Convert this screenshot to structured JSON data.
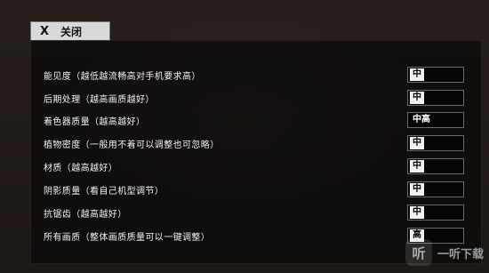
{
  "close_button": {
    "icon": "close-icon",
    "symbol": "X",
    "label": "关闭"
  },
  "settings": [
    {
      "label": "能见度（越低越流畅高对手机要求高）",
      "value": "中"
    },
    {
      "label": "后期处理（越高画质越好）",
      "value": "中"
    },
    {
      "label": "着色器质量（越高越好）",
      "value": "中高"
    },
    {
      "label": "植物密度（一般用不着可以调整也可忽略）",
      "value": "中"
    },
    {
      "label": "材质（越高越好）",
      "value": "中"
    },
    {
      "label": "阴影质量（看自己机型调节）",
      "value": "中"
    },
    {
      "label": "抗锯齿（越高越好）",
      "value": "中"
    },
    {
      "label": "所有画质（整体画质质量可以一键调整）",
      "value": "高"
    }
  ],
  "watermark": {
    "mark": "听",
    "text": "一听下载"
  }
}
